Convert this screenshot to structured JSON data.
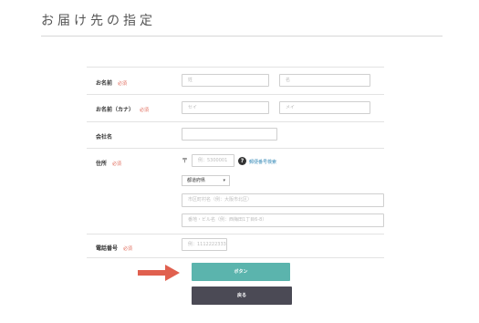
{
  "page": {
    "title": "お届け先の指定"
  },
  "form": {
    "required_badge": "必須",
    "name": {
      "label": "お名前",
      "last_placeholder": "姓",
      "first_placeholder": "名"
    },
    "name_kana": {
      "label": "お名前（カナ）",
      "last_placeholder": "セイ",
      "first_placeholder": "メイ"
    },
    "company": {
      "label": "会社名",
      "placeholder": ""
    },
    "address": {
      "label": "住所",
      "postal_mark": "〒",
      "postal_placeholder": "例：5300001",
      "help_icon_text": "?",
      "postal_search_link": "郵便番号検索",
      "prefecture_selected": "都道府県",
      "city_placeholder": "市区町村名（例：大阪市北区）",
      "street_placeholder": "番地・ビル名（例：西梅田1丁目6-8）"
    },
    "phone": {
      "label": "電話番号",
      "placeholder": "例：11122223333"
    }
  },
  "buttons": {
    "primary_label": "ボタン",
    "back_label": "戻る"
  },
  "colors": {
    "primary": "#5bb4ad",
    "back": "#4b4a55",
    "required": "#e06a5a",
    "link": "#2f86b5",
    "arrow": "#e0604f"
  }
}
